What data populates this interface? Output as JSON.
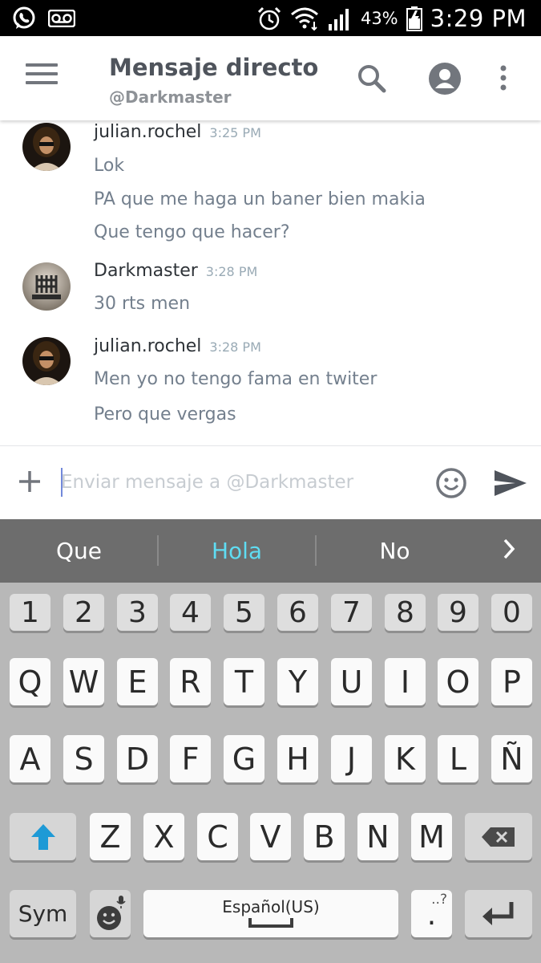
{
  "status_bar": {
    "icons": [
      "whatsapp-icon",
      "voicemail-icon",
      "alarm-icon",
      "wifi-icon",
      "signal-icon",
      "battery-icon"
    ],
    "battery": "43%",
    "time": "3:29 PM"
  },
  "header": {
    "title": "Mensaje directo",
    "subtitle": "@Darkmaster"
  },
  "messages": [
    {
      "author": "julian.rochel",
      "timestamp": "3:25 PM",
      "lines": [
        "Lok",
        "PA que me haga un baner bien makia",
        "Que tengo que hacer?"
      ]
    },
    {
      "author": "Darkmaster",
      "timestamp": "3:28 PM",
      "lines": [
        "30 rts men"
      ]
    },
    {
      "author": "julian.rochel",
      "timestamp": "3:28 PM",
      "lines": [
        "Men yo no tengo fama en twiter",
        "Pero que vergas"
      ]
    }
  ],
  "composer": {
    "placeholder": "Enviar mensaje a @Darkmaster",
    "value": ""
  },
  "suggestions": {
    "words": [
      "Que",
      "Hola",
      "No"
    ],
    "highlighted_index": 1
  },
  "keyboard": {
    "number_row": [
      "1",
      "2",
      "3",
      "4",
      "5",
      "6",
      "7",
      "8",
      "9",
      "0"
    ],
    "row1": [
      "Q",
      "W",
      "E",
      "R",
      "T",
      "Y",
      "U",
      "I",
      "O",
      "P"
    ],
    "row2": [
      "A",
      "S",
      "D",
      "F",
      "G",
      "H",
      "J",
      "K",
      "L",
      "Ñ"
    ],
    "row3": [
      "Z",
      "X",
      "C",
      "V",
      "B",
      "N",
      "M"
    ],
    "sym_label": "Sym",
    "space_label": "Español(US)",
    "period_label": ".",
    "period_hint": "..?"
  },
  "colors": {
    "accent_blurple": "#7289da",
    "suggestion_highlight": "#5fdcf2",
    "shift_arrow": "#1e9ad6"
  }
}
